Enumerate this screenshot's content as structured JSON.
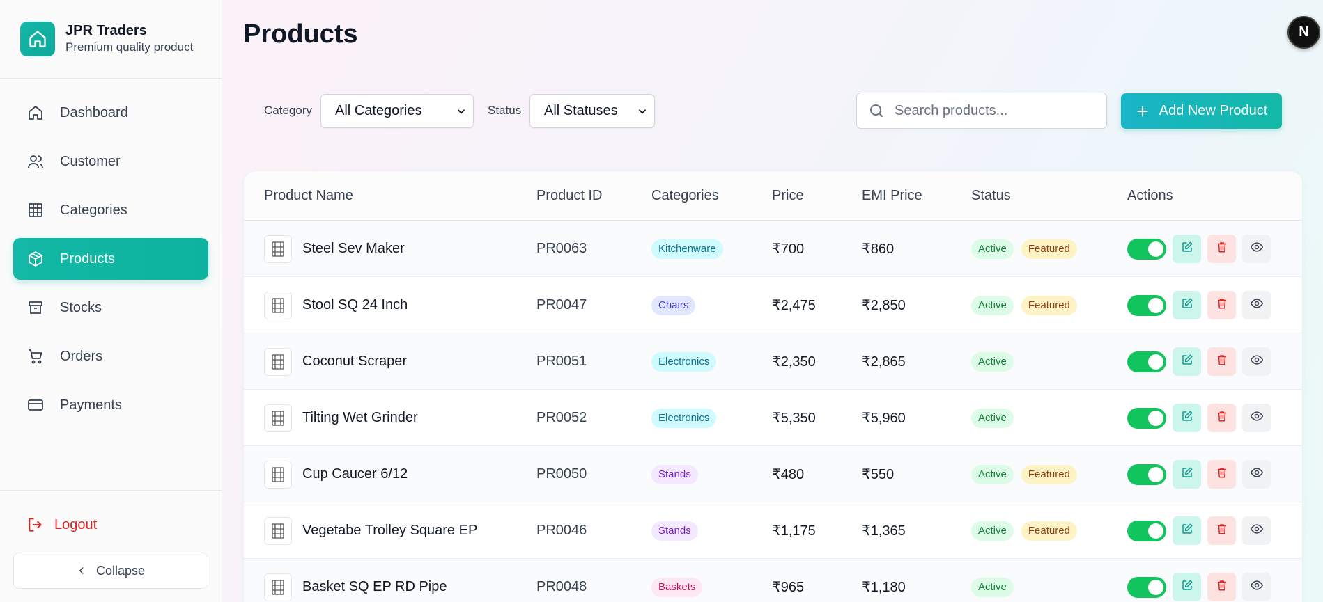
{
  "brand": {
    "title": "JPR Traders",
    "subtitle": "Premium quality product"
  },
  "sidebar": {
    "items": [
      {
        "label": "Dashboard",
        "icon": "home-icon"
      },
      {
        "label": "Customer",
        "icon": "users-icon"
      },
      {
        "label": "Categories",
        "icon": "grid-icon"
      },
      {
        "label": "Products",
        "icon": "box-icon",
        "active": true
      },
      {
        "label": "Stocks",
        "icon": "archive-icon"
      },
      {
        "label": "Orders",
        "icon": "cart-icon"
      },
      {
        "label": "Payments",
        "icon": "credit-card-icon"
      }
    ],
    "logout": "Logout",
    "collapse": "Collapse"
  },
  "page": {
    "title": "Products",
    "avatar": "N"
  },
  "filters": {
    "category_label": "Category",
    "category_value": "All Categories",
    "status_label": "Status",
    "status_value": "All Statuses"
  },
  "search": {
    "placeholder": "Search products..."
  },
  "add_button": "Add New Product",
  "table": {
    "headers": [
      "Product Name",
      "Product ID",
      "Categories",
      "Price",
      "EMI Price",
      "Status",
      "Actions"
    ],
    "rows": [
      {
        "name": "Steel Sev Maker",
        "id": "PR0063",
        "category": "Kitchenware",
        "price": "₹700",
        "emi": "₹860",
        "status": "Active",
        "featured": "Featured"
      },
      {
        "name": "Stool SQ 24 Inch",
        "id": "PR0047",
        "category": "Chairs",
        "price": "₹2,475",
        "emi": "₹2,850",
        "status": "Active",
        "featured": "Featured"
      },
      {
        "name": "Coconut Scraper",
        "id": "PR0051",
        "category": "Electronics",
        "price": "₹2,350",
        "emi": "₹2,865",
        "status": "Active",
        "featured": ""
      },
      {
        "name": "Tilting Wet Grinder",
        "id": "PR0052",
        "category": "Electronics",
        "price": "₹5,350",
        "emi": "₹5,960",
        "status": "Active",
        "featured": ""
      },
      {
        "name": "Cup Caucer 6/12",
        "id": "PR0050",
        "category": "Stands",
        "price": "₹480",
        "emi": "₹550",
        "status": "Active",
        "featured": "Featured"
      },
      {
        "name": "Vegetabe Trolley Square EP",
        "id": "PR0046",
        "category": "Stands",
        "price": "₹1,175",
        "emi": "₹1,365",
        "status": "Active",
        "featured": "Featured"
      },
      {
        "name": "Basket SQ EP RD Pipe",
        "id": "PR0048",
        "category": "Baskets",
        "price": "₹965",
        "emi": "₹1,180",
        "status": "Active",
        "featured": ""
      }
    ]
  },
  "category_colors": {
    "Kitchenware": {
      "bg": "#cffafe",
      "fg": "#0e7490"
    },
    "Chairs": {
      "bg": "#e0e7ff",
      "fg": "#4338ca"
    },
    "Electronics": {
      "bg": "#cffafe",
      "fg": "#0e7490"
    },
    "Stands": {
      "bg": "#f3e8ff",
      "fg": "#7e22ce"
    },
    "Baskets": {
      "bg": "#fce7f3",
      "fg": "#be185d"
    }
  },
  "colors": {
    "accent": "#14b8a6",
    "toggle_on": "#12c45e",
    "danger": "#dc2626"
  }
}
